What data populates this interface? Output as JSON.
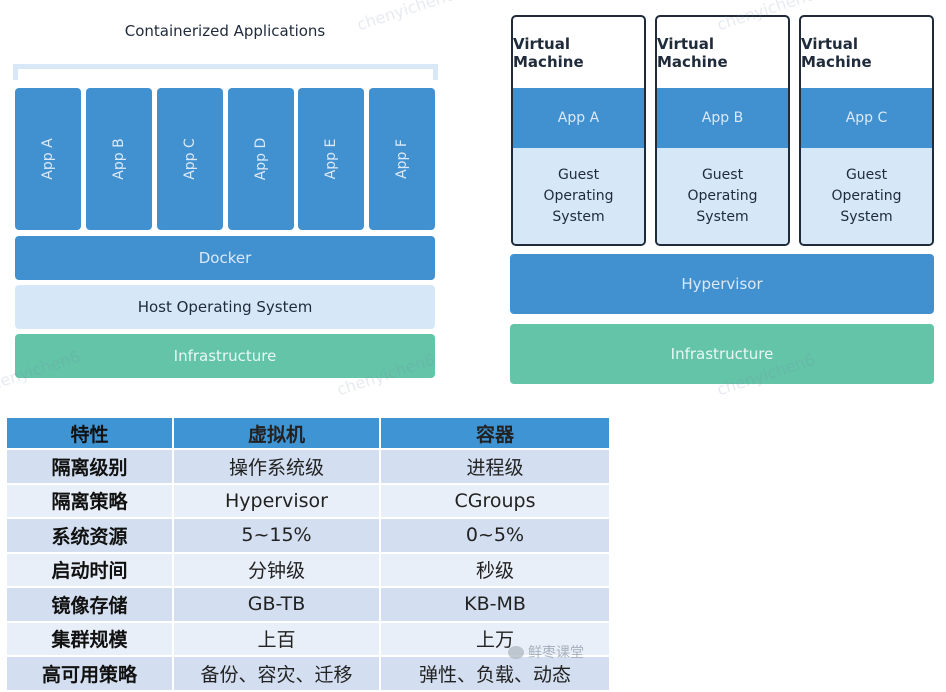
{
  "container_diagram": {
    "title": "Containerized Applications",
    "apps": [
      "App A",
      "App B",
      "App C",
      "App D",
      "App E",
      "App F"
    ],
    "runtime": "Docker",
    "host_os": "Host Operating System",
    "infrastructure": "Infrastructure"
  },
  "vm_diagram": {
    "vms": [
      {
        "title": "Virtual Machine",
        "app": "App A",
        "guest_os": "Guest\nOperating\nSystem"
      },
      {
        "title": "Virtual Machine",
        "app": "App B",
        "guest_os": "Guest\nOperating\nSystem"
      },
      {
        "title": "Virtual Machine",
        "app": "App C",
        "guest_os": "Guest\nOperating\nSystem"
      }
    ],
    "hypervisor": "Hypervisor",
    "infrastructure": "Infrastructure"
  },
  "comparison_table": {
    "headers": [
      "特性",
      "虚拟机",
      "容器"
    ],
    "rows": [
      [
        "隔离级别",
        "操作系统级",
        "进程级"
      ],
      [
        "隔离策略",
        "Hypervisor",
        "CGroups"
      ],
      [
        "系统资源",
        "5~15%",
        "0~5%"
      ],
      [
        "启动时间",
        "分钟级",
        "秒级"
      ],
      [
        "镜像存储",
        "GB-TB",
        "KB-MB"
      ],
      [
        "集群规模",
        "上百",
        "上万"
      ],
      [
        "高可用策略",
        "备份、容灾、迁移",
        "弹性、负载、动态"
      ]
    ]
  },
  "watermarks": {
    "text": "chenyichen6",
    "wechat": "鲜枣课堂"
  },
  "colors": {
    "app_blue": "#4190d0",
    "light_blue": "#d6e8f7",
    "infra_green": "#63c4a8",
    "table_header": "#3f94d4"
  }
}
